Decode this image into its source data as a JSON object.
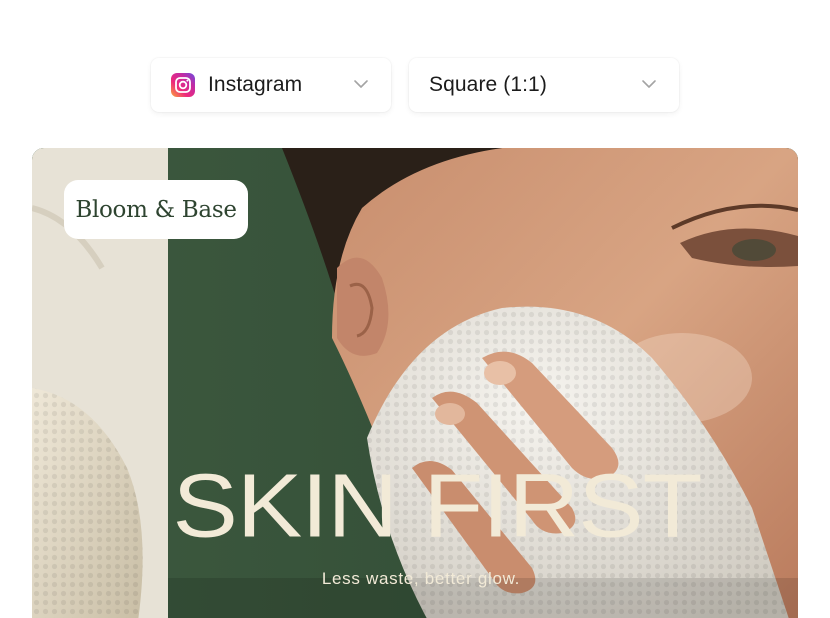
{
  "platform_select": {
    "label": "Instagram",
    "icon": "instagram-icon"
  },
  "format_select": {
    "label": "Square (1:1)"
  },
  "preview": {
    "brand": "Bloom & Base",
    "headline": "SKIN FIRST",
    "tagline": "Less waste, better glow."
  },
  "colors": {
    "brand_green": "#3f5a40",
    "cream_text": "#f2ead7",
    "brand_text": "#2e4430"
  }
}
